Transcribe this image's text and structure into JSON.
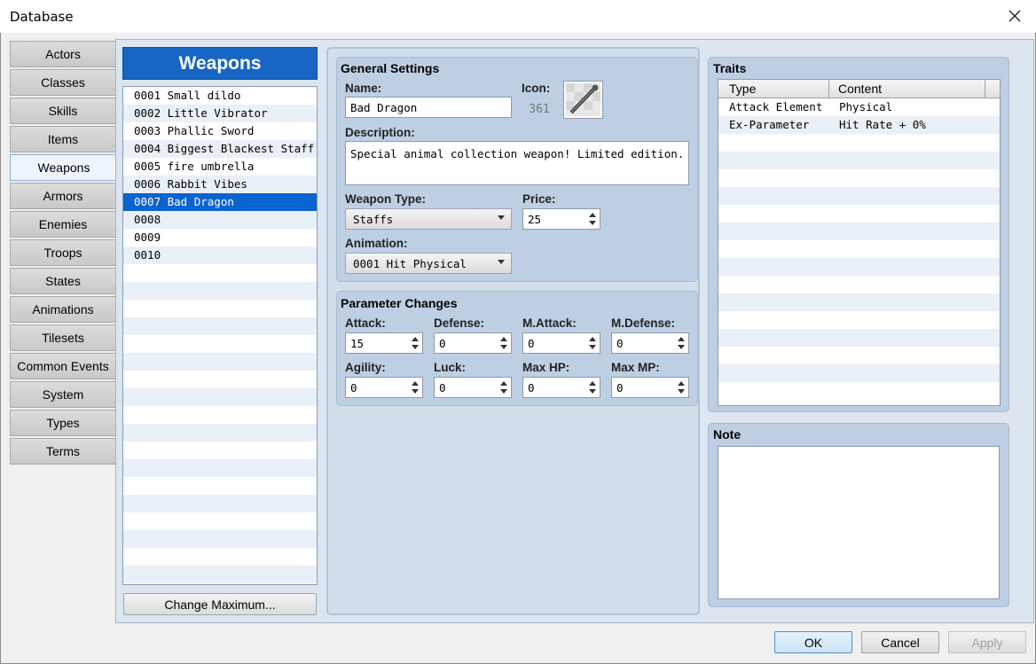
{
  "window": {
    "title": "Database"
  },
  "tabs": [
    "Actors",
    "Classes",
    "Skills",
    "Items",
    "Weapons",
    "Armors",
    "Enemies",
    "Troops",
    "States",
    "Animations",
    "Tilesets",
    "Common Events",
    "System",
    "Types",
    "Terms"
  ],
  "active_tab": "Weapons",
  "list": {
    "header": "Weapons",
    "items": [
      "0001 Small dildo",
      "0002 Little Vibrator",
      "0003 Phallic Sword",
      "0004 Biggest Blackest Staff",
      "0005 fire umbrella",
      "0006 Rabbit Vibes",
      "0007 Bad Dragon",
      "0008",
      "0009",
      "0010"
    ],
    "selected_index": 6,
    "change_max_label": "Change Maximum..."
  },
  "general": {
    "title": "General Settings",
    "name_label": "Name:",
    "name_value": "Bad Dragon",
    "icon_label": "Icon:",
    "icon_index": "361",
    "description_label": "Description:",
    "description_value": "Special animal collection weapon! Limited edition.",
    "weapon_type_label": "Weapon Type:",
    "weapon_type_value": "Staffs",
    "price_label": "Price:",
    "price_value": "25",
    "animation_label": "Animation:",
    "animation_value": "0001 Hit Physical"
  },
  "params": {
    "title": "Parameter Changes",
    "items": [
      {
        "label": "Attack:",
        "value": "15"
      },
      {
        "label": "Defense:",
        "value": "0"
      },
      {
        "label": "M.Attack:",
        "value": "0"
      },
      {
        "label": "M.Defense:",
        "value": "0"
      },
      {
        "label": "Agility:",
        "value": "0"
      },
      {
        "label": "Luck:",
        "value": "0"
      },
      {
        "label": "Max HP:",
        "value": "0"
      },
      {
        "label": "Max MP:",
        "value": "0"
      }
    ]
  },
  "traits": {
    "title": "Traits",
    "col_type": "Type",
    "col_content": "Content",
    "rows": [
      {
        "type": "Attack Element",
        "content": "Physical"
      },
      {
        "type": "Ex-Parameter",
        "content": "Hit Rate + 0%"
      }
    ]
  },
  "note": {
    "title": "Note",
    "value": ""
  },
  "footer": {
    "ok": "OK",
    "cancel": "Cancel",
    "apply": "Apply"
  }
}
